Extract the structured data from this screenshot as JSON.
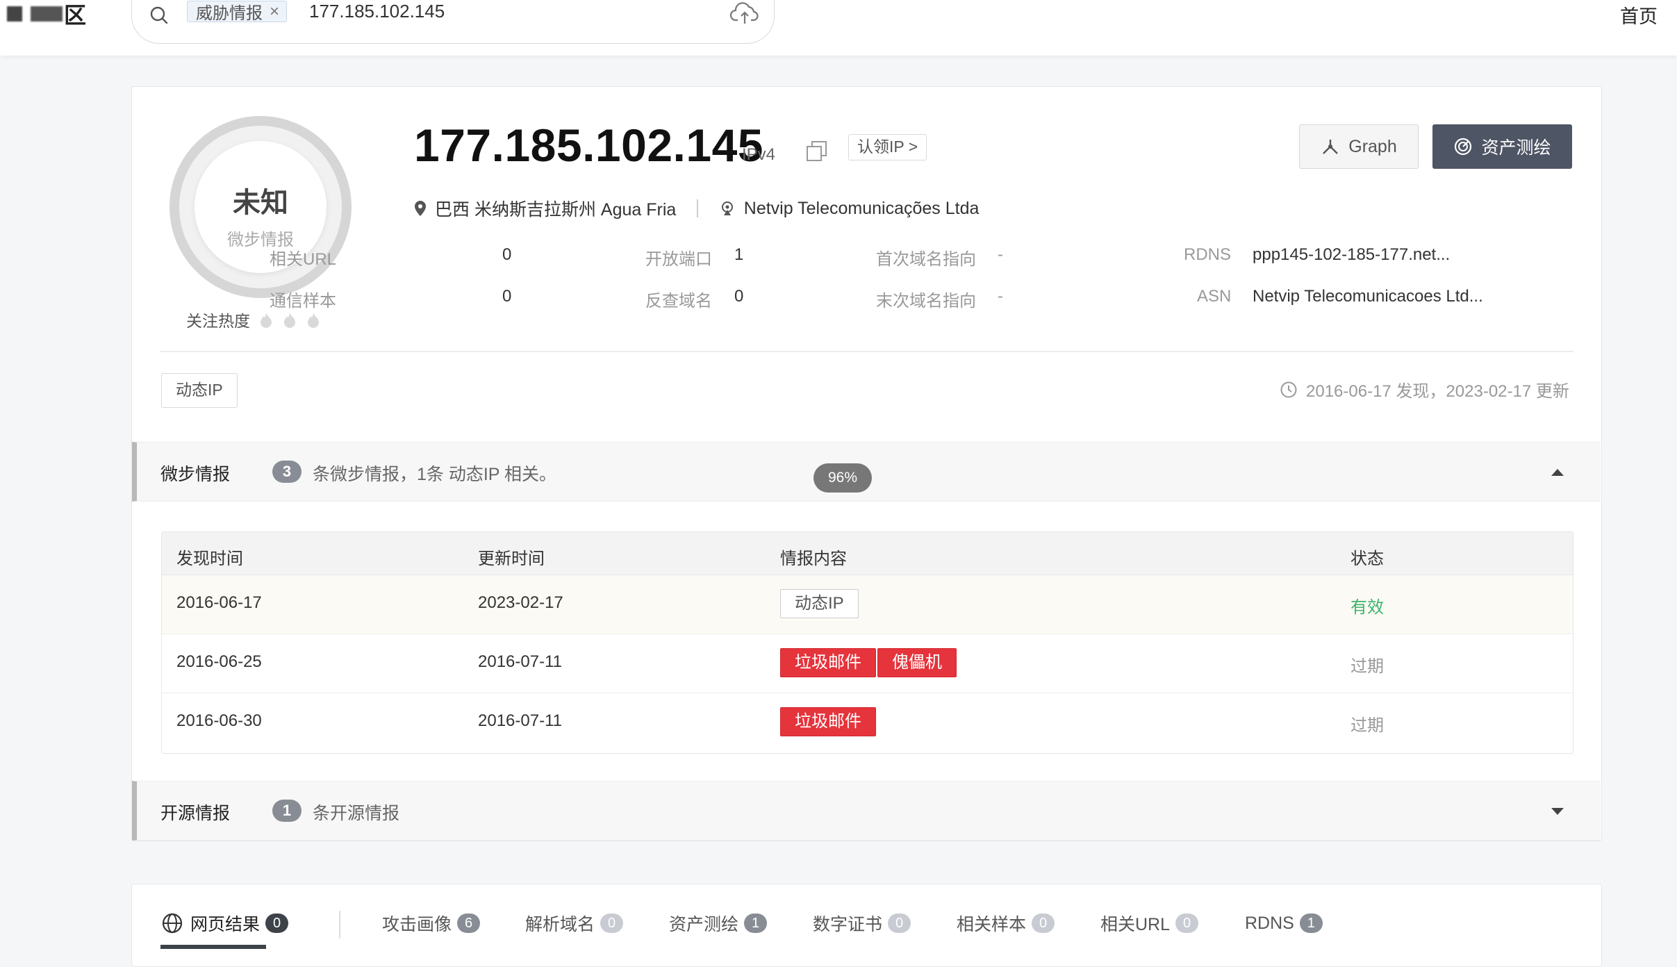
{
  "topbar": {
    "logo_text": "区",
    "search_tag": "威胁情报",
    "search_tag_close": "×",
    "search_query": "177.185.102.145",
    "home_link": "首页"
  },
  "summary": {
    "verdict": "未知",
    "verdict_source": "微步情报",
    "heat_label": "关注热度",
    "ip": "177.185.102.145",
    "ip_version": "IPv4",
    "claim_button": "认领IP >",
    "graph_button": "Graph",
    "asset_button": "资产测绘",
    "location": "巴西 米纳斯吉拉斯州 Agua Fria",
    "isp": "Netvip Telecomunicações Ltda",
    "stats": {
      "related_url_label": "相关URL",
      "related_url_value": "0",
      "comm_samples_label": "通信样本",
      "comm_samples_value": "0",
      "open_ports_label": "开放端口",
      "open_ports_value": "1",
      "reverse_domains_label": "反查域名",
      "reverse_domains_value": "0",
      "first_domain_label": "首次域名指向",
      "first_domain_value": "-",
      "last_domain_label": "末次域名指向",
      "last_domain_value": "-",
      "rdns_label": "RDNS",
      "rdns_value": "ppp145-102-185-177.net...",
      "asn_label": "ASN",
      "asn_value": "Netvip Telecomunicacoes Ltd..."
    },
    "tag": "动态IP",
    "dates": "2016-06-17 发现，2023-02-17 更新"
  },
  "intel_section": {
    "title": "微步情报",
    "count": "3",
    "description": "条微步情报，1条 动态IP 相关。",
    "progress_badge": "96%",
    "columns": [
      "发现时间",
      "更新时间",
      "情报内容",
      "状态"
    ],
    "rows": [
      {
        "found": "2016-06-17",
        "updated": "2023-02-17",
        "tags": [
          "动态IP"
        ],
        "status": "有效"
      },
      {
        "found": "2016-06-25",
        "updated": "2016-07-11",
        "tags": [
          "垃圾邮件",
          "傀儡机"
        ],
        "status": "过期"
      },
      {
        "found": "2016-06-30",
        "updated": "2016-07-11",
        "tags": [
          "垃圾邮件"
        ],
        "status": "过期"
      }
    ]
  },
  "osint_section": {
    "title": "开源情报",
    "count": "1",
    "description": "条开源情报"
  },
  "tabs": [
    {
      "label": "网页结果",
      "count": "0"
    },
    {
      "label": "攻击画像",
      "count": "6"
    },
    {
      "label": "解析域名",
      "count": "0"
    },
    {
      "label": "资产测绘",
      "count": "1"
    },
    {
      "label": "数字证书",
      "count": "0"
    },
    {
      "label": "相关样本",
      "count": "0"
    },
    {
      "label": "相关URL",
      "count": "0"
    },
    {
      "label": "RDNS",
      "count": "1"
    }
  ],
  "colors": {
    "valid_status": "#3bb36b",
    "danger_tag": "#e5343c",
    "primary_button": "#4e5564"
  }
}
